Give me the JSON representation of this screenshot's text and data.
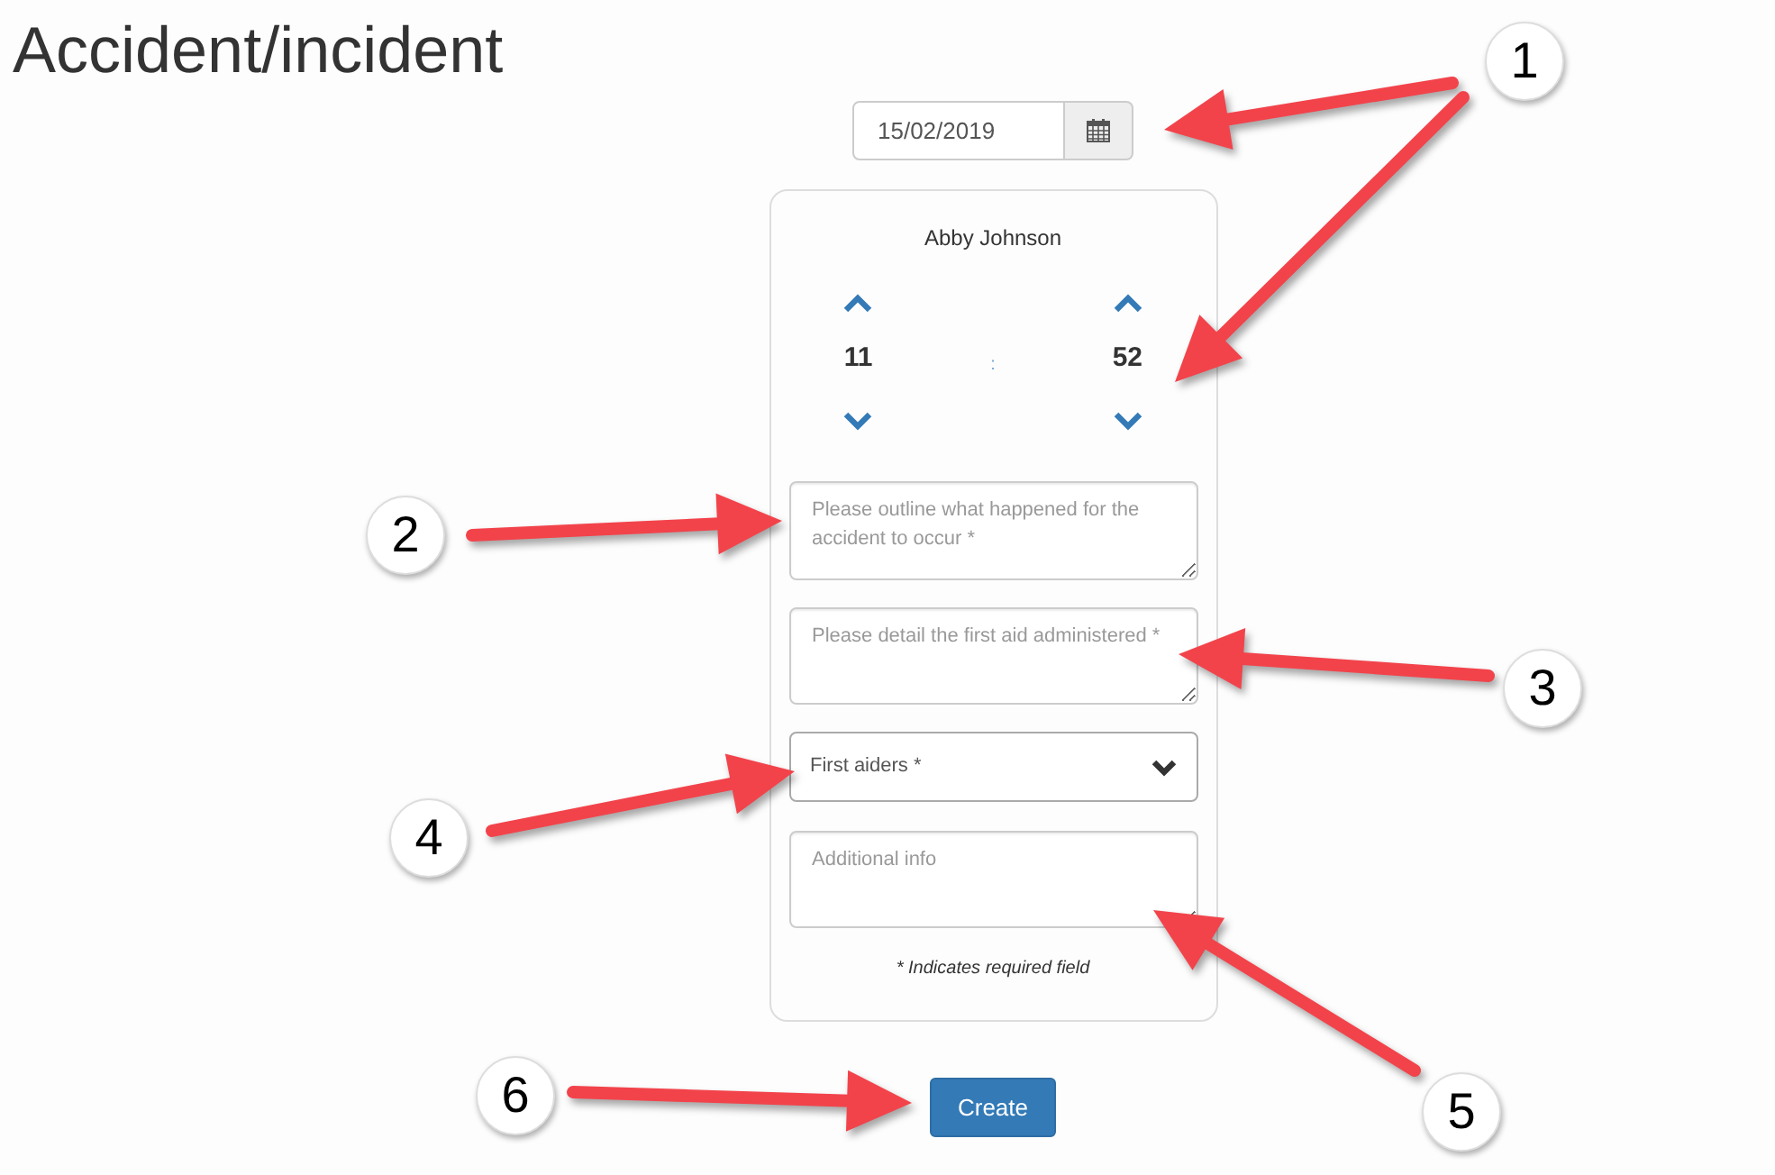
{
  "page": {
    "title": "Accident/incident"
  },
  "date_picker": {
    "value": "15/02/2019"
  },
  "form": {
    "person": "Abby Johnson",
    "time": {
      "hours": "11",
      "separator": ":",
      "minutes": "52"
    },
    "fields": [
      {
        "kind": "textarea",
        "placeholder": "Please outline what happened for the accident to occur *"
      },
      {
        "kind": "textarea",
        "placeholder": "Please detail the first aid administered *"
      },
      {
        "kind": "select",
        "label": "First aiders *"
      },
      {
        "kind": "textarea",
        "placeholder": "Additional info"
      }
    ],
    "note": "* Indicates required field"
  },
  "buttons": [
    {
      "label": "Create"
    }
  ],
  "annotations": [
    {
      "label": "1"
    },
    {
      "label": "2"
    },
    {
      "label": "3"
    },
    {
      "label": "4"
    },
    {
      "label": "5"
    },
    {
      "label": "6"
    }
  ]
}
